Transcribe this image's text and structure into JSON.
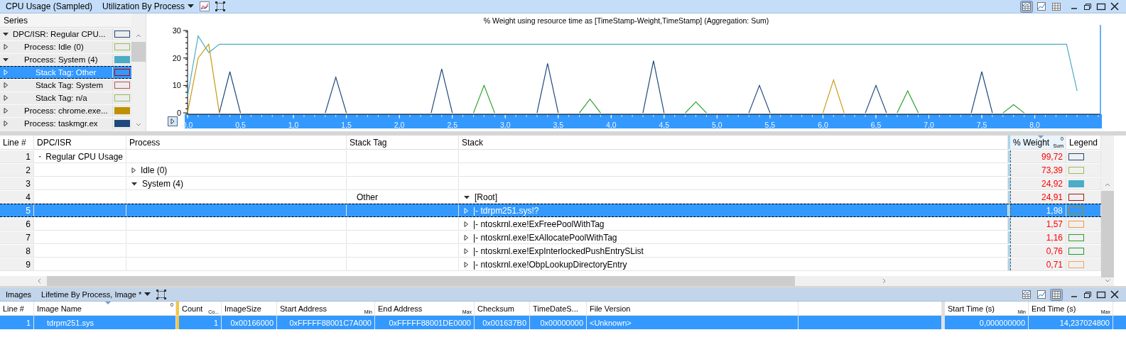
{
  "top_panel": {
    "title": "CPU Usage (Sampled)",
    "preset": "Utilization By Process",
    "view_modes": [
      {
        "kind": "graph_table",
        "selected": true
      },
      {
        "kind": "graph",
        "selected": false
      },
      {
        "kind": "table",
        "selected": false
      }
    ],
    "series_header": "Series",
    "series": [
      {
        "label": "DPC/ISR: Regular CPU...",
        "expanded": true,
        "selected": false,
        "color": "#1f497d",
        "filled": false,
        "children": [
          {
            "label": "Process: Idle (0)",
            "expanded": false,
            "selected": false,
            "color": "#9bbb59",
            "filled": false
          },
          {
            "label": "Process: System (4)",
            "expanded": true,
            "selected": false,
            "color": "#4bacc6",
            "filled": true,
            "children": [
              {
                "label": "Stack Tag: Other",
                "expanded": false,
                "selected": true,
                "color": "#c00000",
                "filled": false
              },
              {
                "label": "Stack Tag: System",
                "expanded": false,
                "selected": false,
                "color": "#c0504d",
                "filled": false
              },
              {
                "label": "Stack Tag: n/a",
                "expanded": false,
                "selected": false,
                "color": "#9bbb59",
                "filled": false
              }
            ]
          },
          {
            "label": "Process: chrome.exe...",
            "expanded": false,
            "selected": false,
            "color": "#bf9000",
            "filled": true
          },
          {
            "label": "Process: taskmgr.ex",
            "expanded": false,
            "selected": false,
            "color": "#1f497d",
            "filled": true
          }
        ]
      }
    ],
    "chart_data": {
      "type": "line",
      "title": "% Weight using resource time as [TimeStamp-Weight,TimeStamp] (Aggregation: Sum)",
      "x": [
        0,
        0.1,
        0.2,
        0.3,
        0.4,
        0.5,
        0.6,
        0.7,
        0.8,
        0.9,
        1,
        1.1,
        1.2,
        1.3,
        1.4,
        1.5,
        1.6,
        1.7,
        1.8,
        1.9,
        2,
        2.1,
        2.2,
        2.3,
        2.4,
        2.5,
        2.6,
        2.7,
        2.8,
        2.9,
        3,
        3.1,
        3.2,
        3.3,
        3.4,
        3.5,
        3.6,
        3.7,
        3.8,
        3.9,
        4,
        4.1,
        4.2,
        4.3,
        4.4,
        4.5,
        4.6,
        4.7,
        4.8,
        4.9,
        5,
        5.1,
        5.2,
        5.3,
        5.4,
        5.5,
        5.6,
        5.7,
        5.8,
        5.9,
        6,
        6.1,
        6.2,
        6.3,
        6.4,
        6.5,
        6.6,
        6.7,
        6.8,
        6.9,
        7,
        7.1,
        7.2,
        7.3,
        7.4,
        7.5,
        7.6,
        7.7,
        7.8,
        7.9,
        8,
        8.1,
        8.2,
        8.3,
        8.4
      ],
      "series": [
        {
          "color": "#4bacc6",
          "values": [
            6,
            28,
            22,
            25,
            25,
            25,
            25,
            25,
            25,
            25,
            25,
            25,
            25,
            25,
            25,
            25,
            25,
            25,
            25,
            25,
            25,
            25,
            25,
            25,
            25,
            25,
            25,
            25,
            25,
            25,
            25,
            25,
            25,
            25,
            25,
            25,
            25,
            25,
            25,
            25,
            25,
            25,
            25,
            25,
            25,
            25,
            25,
            25,
            25,
            25,
            25,
            25,
            25,
            25,
            25,
            25,
            25,
            25,
            25,
            25,
            25,
            25,
            25,
            25,
            25,
            25,
            25,
            25,
            25,
            25,
            25,
            25,
            25,
            25,
            25,
            25,
            25,
            25,
            25,
            25,
            25,
            25,
            25,
            25,
            8
          ]
        },
        {
          "color": "#1f497d",
          "values": [
            null,
            null,
            null,
            0,
            15,
            0,
            null,
            null,
            null,
            null,
            null,
            null,
            null,
            0,
            13,
            0,
            null,
            null,
            null,
            null,
            null,
            null,
            null,
            0,
            16,
            0,
            null,
            null,
            null,
            null,
            null,
            null,
            null,
            0,
            18,
            0,
            null,
            null,
            null,
            null,
            null,
            null,
            null,
            0,
            19,
            0,
            null,
            null,
            null,
            null,
            null,
            null,
            null,
            0,
            10,
            0,
            null,
            null,
            null,
            null,
            null,
            null,
            null,
            null,
            0,
            10,
            0,
            null,
            null,
            null,
            null,
            null,
            null,
            null,
            0,
            15,
            0,
            null,
            null,
            null,
            null,
            null,
            null,
            null,
            null
          ]
        },
        {
          "color": "#2ca02c",
          "values": [
            null,
            null,
            null,
            null,
            null,
            null,
            null,
            null,
            null,
            null,
            null,
            null,
            null,
            null,
            null,
            null,
            null,
            null,
            null,
            null,
            null,
            null,
            null,
            null,
            null,
            null,
            null,
            0,
            10,
            0,
            null,
            null,
            null,
            null,
            null,
            null,
            null,
            0,
            5,
            0,
            null,
            null,
            null,
            null,
            null,
            null,
            null,
            0,
            4,
            0,
            null,
            null,
            null,
            null,
            null,
            null,
            null,
            null,
            null,
            null,
            null,
            null,
            null,
            null,
            null,
            null,
            null,
            0,
            8,
            0,
            null,
            null,
            null,
            null,
            null,
            null,
            null,
            0,
            3,
            0,
            null,
            null,
            null,
            null,
            null
          ]
        },
        {
          "color": "#c99a14",
          "values": [
            0,
            20,
            25,
            0,
            null,
            null,
            null,
            null,
            null,
            null,
            null,
            null,
            null,
            null,
            null,
            null,
            null,
            null,
            null,
            null,
            null,
            null,
            null,
            null,
            null,
            null,
            null,
            null,
            null,
            null,
            null,
            null,
            null,
            null,
            null,
            null,
            null,
            null,
            null,
            null,
            null,
            null,
            null,
            null,
            null,
            null,
            null,
            null,
            null,
            null,
            null,
            null,
            null,
            null,
            null,
            null,
            null,
            null,
            null,
            null,
            0,
            12,
            0,
            null,
            null,
            null,
            null,
            null,
            null,
            null,
            null,
            null,
            null,
            null,
            null,
            null,
            null,
            null,
            null,
            null,
            null,
            null,
            null,
            null,
            null
          ]
        }
      ],
      "xlim": [
        0,
        8.62
      ],
      "ylim": [
        -0.5,
        30
      ],
      "xticks": [
        {
          "value": 0,
          "label": "0,0"
        },
        {
          "value": 0.5,
          "label": "0,5"
        },
        {
          "value": 1,
          "label": "1,0"
        },
        {
          "value": 1.5,
          "label": "1,5"
        },
        {
          "value": 2,
          "label": "2,0"
        },
        {
          "value": 2.5,
          "label": "2,5"
        },
        {
          "value": 3,
          "label": "3,0"
        },
        {
          "value": 3.5,
          "label": "3,5"
        },
        {
          "value": 4,
          "label": "4,0"
        },
        {
          "value": 4.5,
          "label": "4,5"
        },
        {
          "value": 5,
          "label": "5,0"
        },
        {
          "value": 5.5,
          "label": "5,5"
        },
        {
          "value": 6,
          "label": "6,0"
        },
        {
          "value": 6.5,
          "label": "6,5"
        },
        {
          "value": 7,
          "label": "7,0"
        },
        {
          "value": 7.5,
          "label": "7,5"
        },
        {
          "value": 8,
          "label": "8,0"
        }
      ],
      "yticks": [
        0,
        10,
        20,
        30
      ]
    }
  },
  "main_table": {
    "columns": [
      {
        "label": "Line #"
      },
      {
        "label": "DPC/ISR"
      },
      {
        "label": "Process"
      },
      {
        "label": "Stack Tag"
      },
      {
        "label": "Stack"
      },
      {
        "label": "% Weight",
        "aggregate": "Sum",
        "sort_index": "0",
        "sorted": true
      },
      {
        "label": "Legend"
      }
    ],
    "rows": [
      {
        "line": "1",
        "dpc_isr": "Regular CPU Usage",
        "expanded": true,
        "weight": "99,72",
        "color": "#1f497d",
        "filled": false,
        "selected": false
      },
      {
        "line": "2",
        "process": "Idle (0)",
        "expanded": false,
        "weight": "73,39",
        "color": "#9bbb59",
        "filled": false,
        "selected": false
      },
      {
        "line": "3",
        "process": "System (4)",
        "expanded": true,
        "weight": "24,92",
        "color": "#4bacc6",
        "filled": true,
        "selected": false
      },
      {
        "line": "4",
        "stack_tag": "Other",
        "stack": "[Root]",
        "expanded": true,
        "weight": "24,91",
        "color": "#a01818",
        "filled": false,
        "selected": false
      },
      {
        "line": "5",
        "stack": "|- tdrpm251.sys!?",
        "expanded": false,
        "weight": "1,98",
        "color": "#b8860b",
        "filled": false,
        "selected": true
      },
      {
        "line": "6",
        "stack": "|- ntoskrnl.exe!ExFreePoolWithTag",
        "expanded": false,
        "weight": "1,57",
        "color": "#f79646",
        "filled": false,
        "selected": false
      },
      {
        "line": "7",
        "stack": "|- ntoskrnl.exe!ExAllocatePoolWithTag",
        "expanded": false,
        "weight": "1,16",
        "color": "#2ca02c",
        "filled": false,
        "selected": false
      },
      {
        "line": "8",
        "stack": "|- ntoskrnl.exe!ExpInterlockedPushEntrySList",
        "expanded": false,
        "weight": "0,76",
        "color": "#1e9a3a",
        "filled": false,
        "selected": false
      },
      {
        "line": "9",
        "stack": "|- ntoskrnl.exe!ObpLookupDirectoryEntry",
        "expanded": false,
        "weight": "0,71",
        "color": "#f4a460",
        "filled": false,
        "selected": false
      }
    ]
  },
  "images_panel": {
    "title": "Images",
    "preset": "Lifetime By Process, Image *",
    "view_modes": [
      {
        "kind": "graph_table",
        "selected": false
      },
      {
        "kind": "graph",
        "selected": false
      },
      {
        "kind": "table",
        "selected": true
      }
    ],
    "columns": [
      {
        "label": "Line #"
      },
      {
        "label": "Image Name",
        "sorted": true,
        "sort_index": "0"
      },
      {
        "label": "Count",
        "sub": "Co..."
      },
      {
        "label": "ImageSize"
      },
      {
        "label": "Start Address",
        "sub": "Min"
      },
      {
        "label": "End Address",
        "sub": "Max"
      },
      {
        "label": "Checksum"
      },
      {
        "label": "TimeDateS..."
      },
      {
        "label": "File Version"
      },
      {
        "label": "Start Time (s)",
        "sub": "Min"
      },
      {
        "label": "End Time (s)",
        "sub": "Max"
      }
    ],
    "rows": [
      {
        "selected": true,
        "cells": [
          "1",
          "tdrpm251.sys",
          "1",
          "0x00166000",
          "0xFFFFF88001C7A000",
          "0xFFFFF88001DE0000",
          "0x001637B0",
          "0x00000000",
          "<Unknown>",
          "0,000000000",
          "14,237024800"
        ]
      }
    ]
  }
}
